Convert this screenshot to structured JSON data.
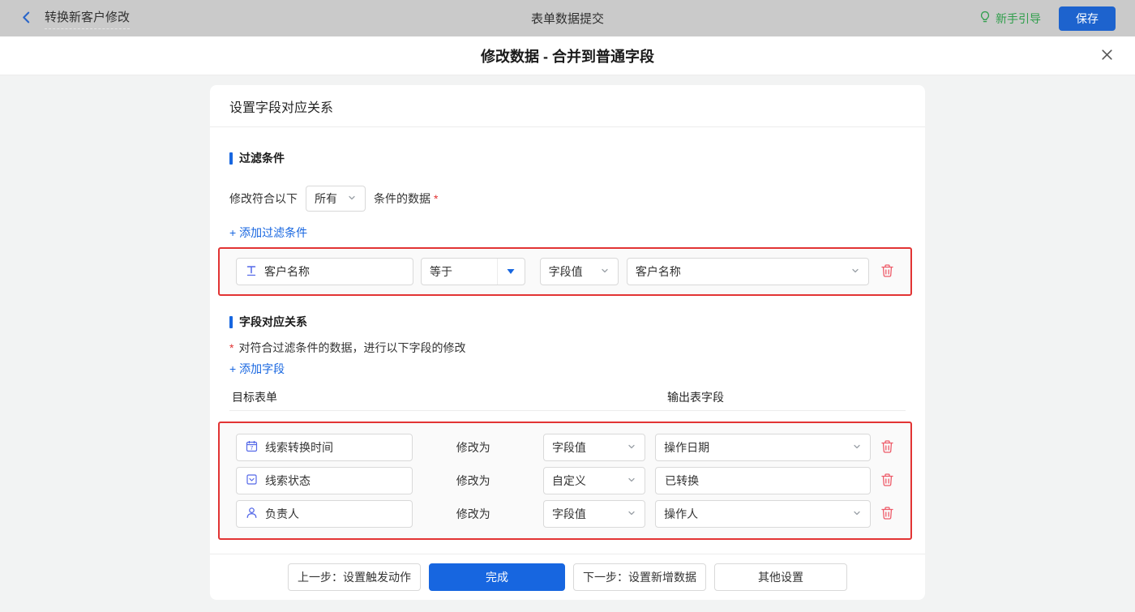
{
  "topbar": {
    "workflow_title": "转换新客户修改",
    "page_title": "表单数据提交",
    "guide_label": "新手引导",
    "save_label": "保存"
  },
  "dialog": {
    "title": "修改数据 - 合并到普通字段"
  },
  "panel": {
    "header": "设置字段对应关系",
    "filter": {
      "section_title": "过滤条件",
      "condition_prefix": "修改符合以下",
      "match_mode": "所有",
      "condition_suffix": "条件的数据",
      "required_mark": "*",
      "add_link": "+ 添加过滤条件",
      "row": {
        "field": "客户名称",
        "operator": "等于",
        "value_type": "字段值",
        "value": "客户名称"
      }
    },
    "mapping": {
      "section_title": "字段对应关系",
      "required_mark": "*",
      "description": "对符合过滤条件的数据，进行以下字段的修改",
      "add_link": "+ 添加字段",
      "column_left": "目标表单",
      "column_right": "输出表字段",
      "modify_label": "修改为",
      "rows": [
        {
          "field": "线索转换时间",
          "value_type": "字段值",
          "value": "操作日期"
        },
        {
          "field": "线索状态",
          "value_type": "自定义",
          "value": "已转换"
        },
        {
          "field": "负责人",
          "value_type": "字段值",
          "value": "操作人"
        }
      ]
    },
    "footer": {
      "prev": "上一步：设置触发动作",
      "done": "完成",
      "next": "下一步：设置新增数据",
      "other": "其他设置"
    }
  },
  "icons": {
    "back": "chevron-left",
    "guide": "lightbulb",
    "close": "x",
    "filter_field_type": "text-field",
    "mapping_field_types": [
      "calendar",
      "select-box",
      "person"
    ],
    "delete": "trash",
    "select_caret": "chevron-down",
    "operator_caret": "triangle-down"
  },
  "colors": {
    "primary_blue": "#1766e0",
    "link_blue": "#1766e0",
    "highlight_red": "#e23434",
    "trash_red": "#ee5a68",
    "guide_green": "#2f9e4b",
    "field_icon_blue": "#5468e8",
    "topbar_gray": "#cacaca",
    "page_bg": "#f2f3f3"
  }
}
